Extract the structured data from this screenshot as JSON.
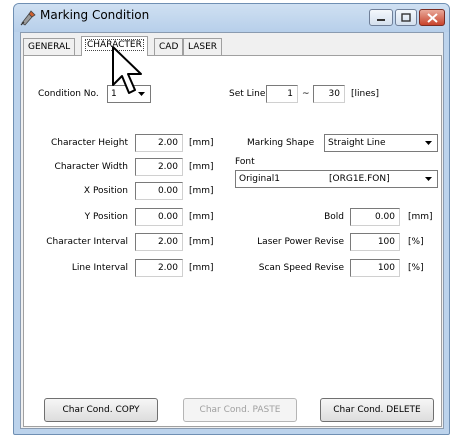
{
  "window": {
    "title": "Marking Condition"
  },
  "tabs": [
    {
      "label": "GENERAL",
      "active": false
    },
    {
      "label": "CHARACTER",
      "active": true
    },
    {
      "label": "CAD",
      "active": false
    },
    {
      "label": "LASER",
      "active": false
    }
  ],
  "condition": {
    "label": "Condition No.",
    "value": "1"
  },
  "set_line": {
    "label": "Set Line",
    "from": "1",
    "separator": "~",
    "to": "30",
    "unit": "[lines]"
  },
  "left_fields": [
    {
      "label": "Character Height",
      "value": "2.00",
      "unit": "[mm]"
    },
    {
      "label": "Character Width",
      "value": "2.00",
      "unit": "[mm]"
    },
    {
      "label": "X Position",
      "value": "0.00",
      "unit": "[mm]"
    },
    {
      "label": "Y Position",
      "value": "0.00",
      "unit": "[mm]"
    },
    {
      "label": "Character Interval",
      "value": "2.00",
      "unit": "[mm]"
    },
    {
      "label": "Line Interval",
      "value": "2.00",
      "unit": "[mm]"
    }
  ],
  "marking_shape": {
    "label": "Marking Shape",
    "value": "Straight Line"
  },
  "font": {
    "label": "Font",
    "name": "Original1",
    "file": "[ORG1E.FON]"
  },
  "bold": {
    "label": "Bold",
    "value": "0.00",
    "unit": "[mm]"
  },
  "laser_power": {
    "label": "Laser Power Revise",
    "value": "100",
    "unit": "[%]"
  },
  "scan_speed": {
    "label": "Scan Speed Revise",
    "value": "100",
    "unit": "[%]"
  },
  "buttons": {
    "copy": "Char Cond. COPY",
    "paste": "Char Cond. PASTE",
    "delete": "Char Cond. DELETE"
  },
  "icons": {
    "app": "marking-tool-icon",
    "minimize": "minimize-icon",
    "maximize": "maximize-icon",
    "close": "close-icon",
    "dropdown": "dropdown-arrow-icon",
    "cursor": "mouse-pointer-icon"
  },
  "colors": {
    "close_button": "#c8432c",
    "title_bar": "#bcd3ec",
    "disabled_text": "#a0a0a0"
  }
}
